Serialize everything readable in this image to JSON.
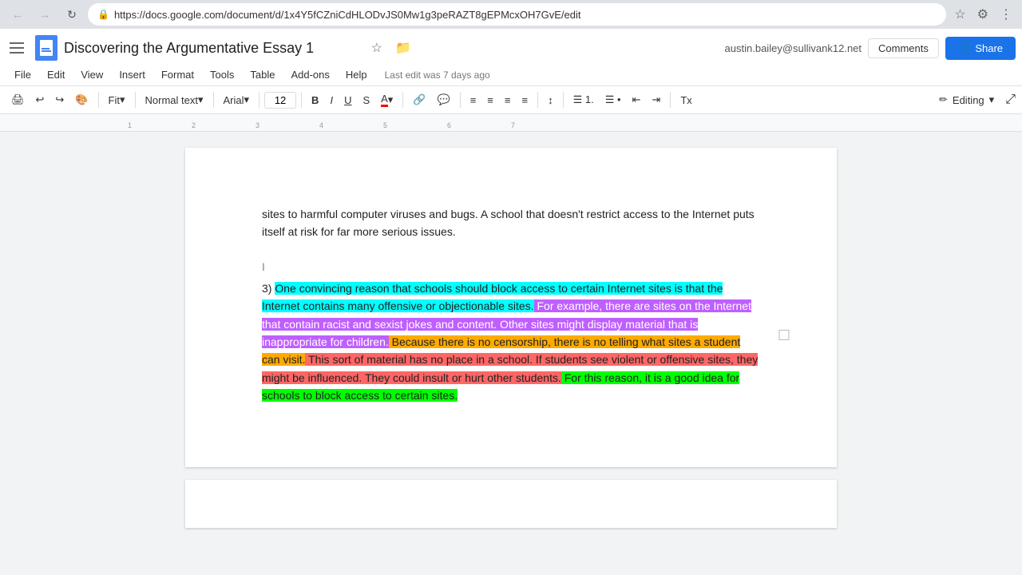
{
  "browser": {
    "url": "https://docs.google.com/document/d/1x4Y5fCZniCdHLODvJS0Mw1g3peRAZT8gEPMcxOH7GvE/edit",
    "secure_label": "Secure",
    "back_btn": "←",
    "forward_btn": "→",
    "refresh_btn": "↻"
  },
  "header": {
    "title": "Discovering the Argumentative Essay 1",
    "star_icon": "☆",
    "folder_icon": "📁",
    "user_email": "austin.bailey@sullivank12.net",
    "comments_label": "Comments",
    "share_label": "Share",
    "share_icon": "👤"
  },
  "menu": {
    "items": [
      "File",
      "Edit",
      "View",
      "Insert",
      "Format",
      "Tools",
      "Table",
      "Add-ons",
      "Help"
    ],
    "last_edit": "Last edit was 7 days ago"
  },
  "toolbar": {
    "print_icon": "🖨",
    "undo_icon": "↩",
    "redo_icon": "↪",
    "paint_icon": "🎨",
    "zoom_label": "Fit",
    "style_label": "Normal text",
    "font_label": "Arial",
    "font_size": "12",
    "bold_label": "B",
    "italic_label": "I",
    "underline_label": "U",
    "strikethrough_label": "S",
    "text_color_label": "A",
    "link_icon": "🔗",
    "comment_icon": "💬",
    "align_left": "≡",
    "align_center": "≡",
    "align_right": "≡",
    "align_justify": "≡",
    "line_spacing": "↕",
    "list_ordered": "1.",
    "list_bullet": "•",
    "indent_less": "←",
    "indent_more": "→",
    "clear_format": "Tx",
    "editing_label": "Editing",
    "pencil_icon": "✏"
  },
  "document": {
    "top_text": "sites to harmful computer viruses and bugs. A school that doesn't restrict access to the Internet puts itself at risk for far more serious issues.",
    "paragraph_3_label": "3)",
    "paragraph_3_text": {
      "cyan_1": "One convincing reason that schools should block access to certain Internet sites is that the Internet contains many offensive or objectionable sites.",
      "purple_1": " For example, there are sites on the Internet that contain racist and sexist jokes and content. Other sites might display material that is inappropriate for children.",
      "orange_1": " Because there is no censorship, there is no telling what sites a student can visit.",
      "red_1": " This sort of material has no place in a school. If students see violent or offensive sites, they might be influenced. They could insult or hurt other students.",
      "green_1": " For this reason, it is a good idea for schools to block access to certain sites."
    }
  }
}
